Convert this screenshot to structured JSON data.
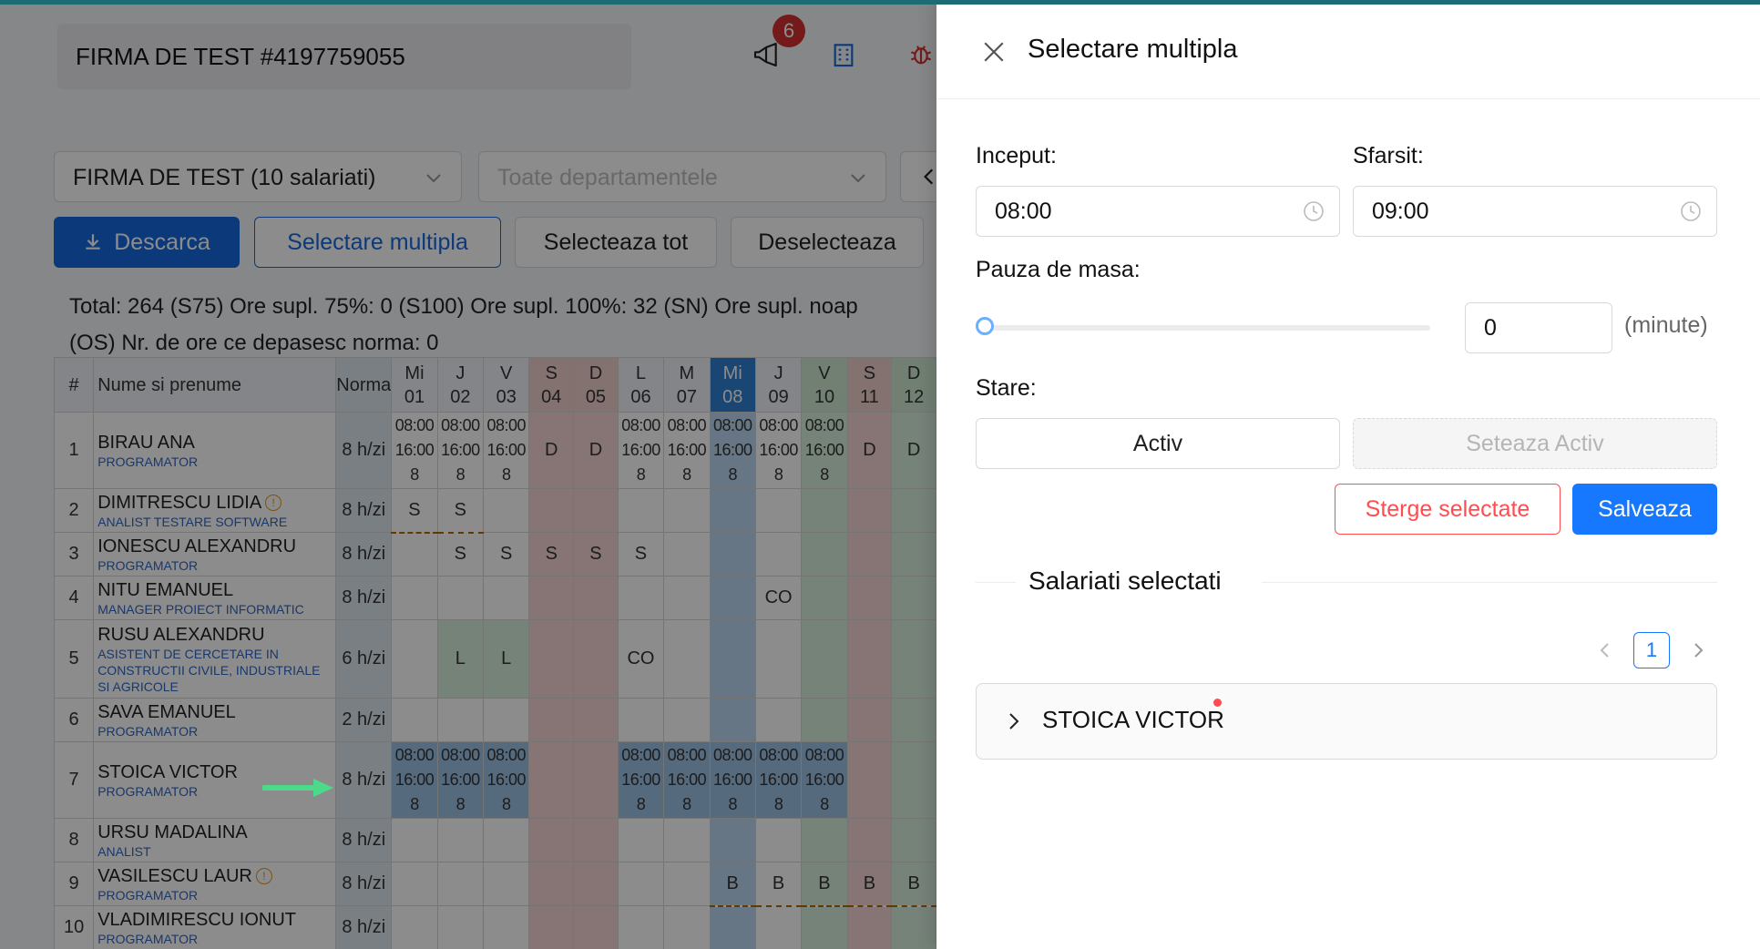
{
  "header": {
    "company": "FIRMA DE TEST #4197759055",
    "notifications_count": "6",
    "icons": [
      "megaphone-icon",
      "building-icon",
      "bug-icon"
    ]
  },
  "filters": {
    "company_select": "FIRMA DE TEST (10 salariati)",
    "department_select": "Toate departamentele"
  },
  "toolbar": {
    "download": "Descarca",
    "multi_select": "Selectare multipla",
    "select_all": "Selecteaza tot",
    "deselect": "Deselecteaza"
  },
  "totals": {
    "line1": "Total: 264   (S75) Ore supl. 75%: 0   (S100) Ore supl. 100%: 32   (SN) Ore supl. noap",
    "line2": "(OS) Nr. de ore ce depasesc norma: 0"
  },
  "table": {
    "headers": {
      "num": "#",
      "name": "Nume si prenume",
      "norma": "Norma"
    },
    "days": [
      {
        "dow": "Mi",
        "day": "01"
      },
      {
        "dow": "J",
        "day": "02"
      },
      {
        "dow": "V",
        "day": "03"
      },
      {
        "dow": "S",
        "day": "04"
      },
      {
        "dow": "D",
        "day": "05"
      },
      {
        "dow": "L",
        "day": "06"
      },
      {
        "dow": "M",
        "day": "07"
      },
      {
        "dow": "Mi",
        "day": "08"
      },
      {
        "dow": "J",
        "day": "09"
      },
      {
        "dow": "V",
        "day": "10"
      },
      {
        "dow": "S",
        "day": "11"
      },
      {
        "dow": "D",
        "day": "12"
      }
    ],
    "rows": [
      {
        "num": "1",
        "name": "BIRAU ANA",
        "role": "PROGRAMATOR",
        "norma": "8 h/zi"
      },
      {
        "num": "2",
        "name": "DIMITRESCU LIDIA",
        "role": "ANALIST TESTARE SOFTWARE",
        "norma": "8 h/zi"
      },
      {
        "num": "3",
        "name": "IONESCU ALEXANDRU",
        "role": "PROGRAMATOR",
        "norma": "8 h/zi"
      },
      {
        "num": "4",
        "name": "NITU EMANUEL",
        "role": "MANAGER PROIECT INFORMATIC",
        "norma": "8 h/zi"
      },
      {
        "num": "5",
        "name": "RUSU ALEXANDRU",
        "role": "ASISTENT DE CERCETARE IN CONSTRUCTII CIVILE, INDUSTRIALE SI AGRICOLE",
        "norma": "6 h/zi"
      },
      {
        "num": "6",
        "name": "SAVA EMANUEL",
        "role": "PROGRAMATOR",
        "norma": "2 h/zi"
      },
      {
        "num": "7",
        "name": "STOICA VICTOR",
        "role": "PROGRAMATOR",
        "norma": "8 h/zi"
      },
      {
        "num": "8",
        "name": "URSU MADALINA",
        "role": "ANALIST",
        "norma": "8 h/zi"
      },
      {
        "num": "9",
        "name": "VASILESCU LAUR",
        "role": "PROGRAMATOR",
        "norma": "8 h/zi"
      },
      {
        "num": "10",
        "name": "VLADIMIRESCU IONUT",
        "role": "PROGRAMATOR",
        "norma": "8 h/zi"
      }
    ],
    "shift_text": {
      "start": "08:00",
      "end": "16:00",
      "hours": "8"
    },
    "codes": {
      "S": "S",
      "D": "D",
      "L": "L",
      "CO": "CO",
      "B": "B"
    }
  },
  "drawer": {
    "title": "Selectare multipla",
    "start_label": "Inceput:",
    "start_value": "08:00",
    "end_label": "Sfarsit:",
    "end_value": "09:00",
    "break_label": "Pauza de masa:",
    "break_value": "0",
    "break_unit": "(minute)",
    "break_slider_fraction": 0,
    "status_label": "Stare:",
    "status_value": "Activ",
    "set_active": "Seteaza Activ",
    "delete_selected": "Sterge selectate",
    "save": "Salveaza",
    "selected_title": "Salariati selectati",
    "page": "1",
    "selected_employees": [
      "STOICA VICTOR"
    ]
  },
  "colors": {
    "primary": "#1668dc",
    "danger": "#ff4d4f",
    "weekend": "#f4d6d4",
    "holiday_green": "#d7eedc",
    "today_header": "#2f80d0",
    "arrow": "#4cd98a"
  }
}
